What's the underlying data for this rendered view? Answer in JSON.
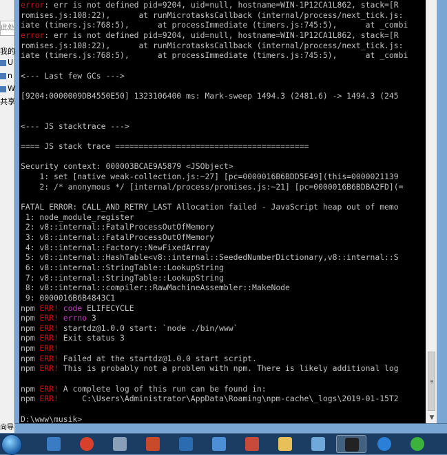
{
  "background_window": {
    "search_placeholder": "此处",
    "items": [
      "我的",
      "U",
      "n",
      "W",
      "共享"
    ],
    "bottom_text": "向导"
  },
  "console": {
    "lines": [
      {
        "prefix": "error",
        "text": ": err is not defined pid=9204, uid=null, hostname=WIN-1P12CA1L862, stack=[R"
      },
      {
        "prefix": "",
        "text": "romises.js:108:22),      at runMicrotasksCallback (internal/process/next_tick.js:"
      },
      {
        "prefix": "",
        "text": "iate (timers.js:768:5),      at processImmediate (timers.js:745:5),      at _combi"
      },
      {
        "prefix": "error",
        "text": ": err is not defined pid=9204, uid=null, hostname=WIN-1P12CA1L862, stack=[R"
      },
      {
        "prefix": "",
        "text": "romises.js:108:22),      at runMicrotasksCallback (internal/process/next_tick.js:"
      },
      {
        "prefix": "",
        "text": "iate (timers.js:768:5),      at processImmediate (timers.js:745:5),      at _combi"
      },
      {
        "prefix": "",
        "text": ""
      },
      {
        "prefix": "",
        "text": "<--- Last few GCs --->"
      },
      {
        "prefix": "",
        "text": ""
      },
      {
        "prefix": "",
        "text": "[9204:0000009DB4550E50] 1323106400 ms: Mark-sweep 1494.3 (2481.6) -> 1494.3 (245"
      },
      {
        "prefix": "",
        "text": ""
      },
      {
        "prefix": "",
        "text": ""
      },
      {
        "prefix": "",
        "text": "<--- JS stacktrace --->"
      },
      {
        "prefix": "",
        "text": ""
      },
      {
        "prefix": "",
        "text": "==== JS stack trace ========================================="
      },
      {
        "prefix": "",
        "text": ""
      },
      {
        "prefix": "",
        "text": "Security context: 000003BCAE9A5879 <JSObject>"
      },
      {
        "prefix": "",
        "text": "    1: set [native weak-collection.js:~27] [pc=0000016B6BDD5E49](this=0000021139"
      },
      {
        "prefix": "",
        "text": "    2: /* anonymous */ [internal/process/promises.js:~21] [pc=0000016B6BDBA2FD](="
      },
      {
        "prefix": "",
        "text": ""
      },
      {
        "prefix": "",
        "text": "FATAL ERROR: CALL_AND_RETRY_LAST Allocation failed - JavaScript heap out of memo"
      },
      {
        "prefix": "",
        "text": " 1: node_module_register"
      },
      {
        "prefix": "",
        "text": " 2: v8::internal::FatalProcessOutOfMemory"
      },
      {
        "prefix": "",
        "text": " 3: v8::internal::FatalProcessOutOfMemory"
      },
      {
        "prefix": "",
        "text": " 4: v8::internal::Factory::NewFixedArray"
      },
      {
        "prefix": "",
        "text": " 5: v8::internal::HashTable<v8::internal::SeededNumberDictionary,v8::internal::S"
      },
      {
        "prefix": "",
        "text": " 6: v8::internal::StringTable::LookupString"
      },
      {
        "prefix": "",
        "text": " 7: v8::internal::StringTable::LookupString"
      },
      {
        "prefix": "",
        "text": " 8: v8::internal::compiler::RawMachineAssembler::MakeNode"
      },
      {
        "prefix": "",
        "text": " 9: 0000016B6B4843C1"
      },
      {
        "prefix": "npm ERR!",
        "text": " code ELIFECYCLE"
      },
      {
        "prefix": "npm ERR!",
        "text": " errno 3"
      },
      {
        "prefix": "npm ERR!",
        "text": " startdz@1.0.0 start: `node ./bin/www`"
      },
      {
        "prefix": "npm ERR!",
        "text": " Exit status 3"
      },
      {
        "prefix": "npm ERR!",
        "text": ""
      },
      {
        "prefix": "npm ERR!",
        "text": " Failed at the startdz@1.0.0 start script."
      },
      {
        "prefix": "npm ERR!",
        "text": " This is probably not a problem with npm. There is likely additional log"
      },
      {
        "prefix": "",
        "text": ""
      },
      {
        "prefix": "npm ERR!",
        "text": " A complete log of this run can be found in:"
      },
      {
        "prefix": "npm ERR!",
        "text": "     C:\\Users\\Administrator\\AppData\\Roaming\\npm-cache\\_logs\\2019-01-15T2"
      },
      {
        "prefix": "",
        "text": ""
      },
      {
        "prefix": "",
        "text": "D:\\www\\musik>_"
      }
    ]
  },
  "taskbar": {
    "icons": [
      "start-orb-icon",
      "server-manager-icon",
      "chrome-icon",
      "performance-monitor-icon",
      "filezilla-icon",
      "iis-manager-icon",
      "vmware-icon",
      "dreamweaver-icon",
      "folder-icon",
      "notepad-icon",
      "cmd-icon",
      "teamviewer-icon",
      "green-app-icon"
    ]
  },
  "colors": {
    "console_bg": "#000000",
    "console_text": "#c0c0c0",
    "error_red": "#d01010",
    "taskbar": "#1b3d63"
  }
}
